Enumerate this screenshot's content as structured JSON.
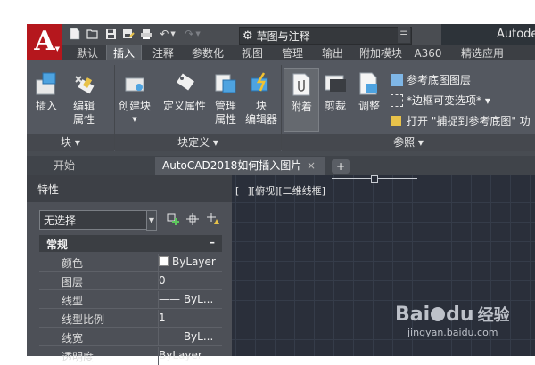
{
  "app": {
    "title": "Autode",
    "logo_letter": "A",
    "workspace": "草图与注释"
  },
  "quick_access": [
    "new-icon",
    "open-icon",
    "save-icon",
    "save-as-icon",
    "print-icon",
    "undo-icon",
    "redo-icon"
  ],
  "ribbon_tabs": [
    "默认",
    "插入",
    "注释",
    "参数化",
    "视图",
    "管理",
    "输出",
    "附加模块",
    "A360",
    "精选应用"
  ],
  "ribbon_active_tab": "插入",
  "panels": {
    "block": {
      "footer": "块 ▾",
      "insert": "插入",
      "edit_attr_1": "编辑",
      "edit_attr_2": "属性"
    },
    "block_def": {
      "footer": "块定义 ▾",
      "create_block": "创建块",
      "define_attr": "定义属性",
      "manage_attr_1": "管理",
      "manage_attr_2": "属性",
      "block_editor_1": "块",
      "block_editor_2": "编辑器"
    },
    "reference": {
      "footer": "参照 ▾",
      "attach": "附着",
      "clip": "剪裁",
      "adjust": "调整",
      "underlay_layers": "参考底图图层",
      "frame_option": "*边框可变选项* ▾",
      "snap_option": "打开 \"捕捉到参考底图\" 功"
    }
  },
  "doc_tabs": {
    "start": "开始",
    "drawing": "AutoCAD2018如何插入图片",
    "close_symbol": "×",
    "add_symbol": "+"
  },
  "properties": {
    "title": "特性",
    "selection": "无选择",
    "category": "常规",
    "category_collapse": "–",
    "rows": [
      {
        "key": "颜色",
        "value": "ByLayer",
        "swatch": "#ffffff"
      },
      {
        "key": "图层",
        "value": "0"
      },
      {
        "key": "线型",
        "value": "—— ByL..."
      },
      {
        "key": "线型比例",
        "value": "1"
      },
      {
        "key": "线宽",
        "value": "—— ByL..."
      },
      {
        "key": "透明度",
        "value": "ByLayer"
      }
    ]
  },
  "canvas": {
    "view_label": "[−][俯视][二维线框]",
    "bg_color": "#2a2f3a"
  },
  "watermark": {
    "brand_a": "Bai",
    "brand_b": "du",
    "brand_c": "经验",
    "url": "jingyan.baidu.com"
  },
  "colors": {
    "accent_red": "#b5171d",
    "ribbon_bg": "#545860",
    "panel_bg": "#4d5057"
  }
}
